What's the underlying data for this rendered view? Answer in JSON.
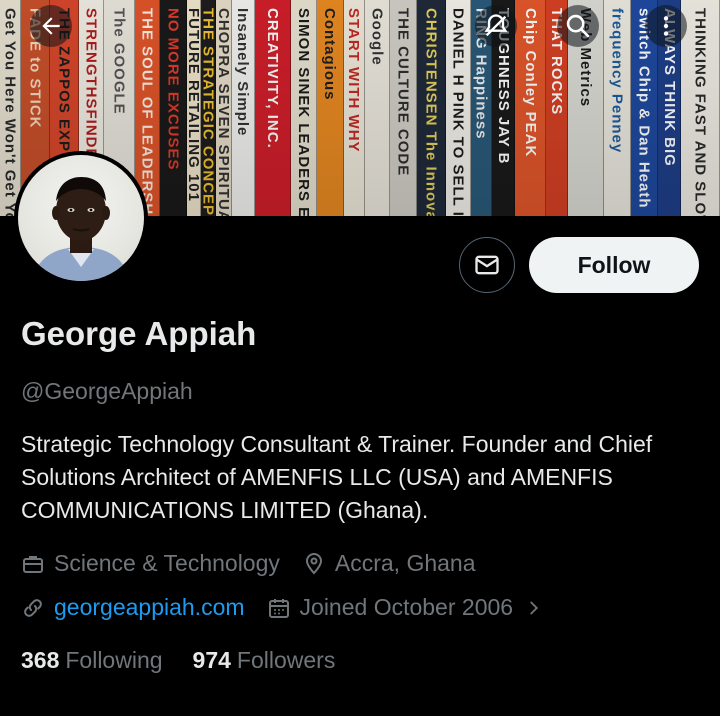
{
  "banner": {
    "books": [
      {
        "text": "Get You Here Won't Get You There",
        "bg": "#e8e2d2",
        "fg": "#2a2a2a",
        "w": 22
      },
      {
        "text": "FADE to STICK",
        "bg": "#c9502a",
        "fg": "#f1d9c0",
        "w": 30
      },
      {
        "text": "THE ZAPPOS EXP",
        "bg": "#d8472b",
        "fg": "#1c1c1c",
        "w": 30
      },
      {
        "text": "STRENGTHSFINDER",
        "bg": "#f0ede4",
        "fg": "#b21d1d",
        "w": 26
      },
      {
        "text": "The GOOGLE",
        "bg": "#e9e6dd",
        "fg": "#555",
        "w": 32
      },
      {
        "text": "THE SOUL OF LEADERSHIP",
        "bg": "#e0552a",
        "fg": "#fbeee4",
        "w": 26
      },
      {
        "text": "NO MORE EXCUSES",
        "bg": "#1a1a1a",
        "fg": "#e03b2a",
        "w": 28
      },
      {
        "text": "FUTURE RETAILING 101",
        "bg": "#f1e6cc",
        "fg": "#222",
        "w": 14
      },
      {
        "text": "THE STRATEGIC CONCEPTS",
        "bg": "#1d1d1d",
        "fg": "#f2c230",
        "w": 16
      },
      {
        "text": "CHOPRA SEVEN SPIRITUAL LAWS",
        "bg": "#e7ddc8",
        "fg": "#333",
        "w": 16
      },
      {
        "text": "Insanely Simple",
        "bg": "#f2f2f0",
        "fg": "#333",
        "w": 24
      },
      {
        "text": "CREATIVITY, INC.",
        "bg": "#d11f2a",
        "fg": "#ffffff",
        "w": 38
      },
      {
        "text": "SIMON SINEK LEADERS EAT",
        "bg": "#e8e2d0",
        "fg": "#1b1b1b",
        "w": 26
      },
      {
        "text": "Contagious",
        "bg": "#e98a22",
        "fg": "#1f1f1f",
        "w": 28
      },
      {
        "text": "START WITH WHY",
        "bg": "#efe9db",
        "fg": "#c22a23",
        "w": 22
      },
      {
        "text": "Google",
        "bg": "#ece8de",
        "fg": "#333",
        "w": 26
      },
      {
        "text": "THE CULTURE CODE",
        "bg": "#d2cfc7",
        "fg": "#2e2e2e",
        "w": 28
      },
      {
        "text": "CHRISTENSEN The Innovator's Dilemma",
        "bg": "#1f2a3a",
        "fg": "#e8d25a",
        "w": 30
      },
      {
        "text": "DANIEL H PINK TO SELL IS HUMAN",
        "bg": "#f3f1ea",
        "fg": "#1c1c1c",
        "w": 26
      },
      {
        "text": "RING Happiness",
        "bg": "#2a5a7a",
        "fg": "#f0f0f0",
        "w": 22
      },
      {
        "text": "TOUGHNESS JAY B",
        "bg": "#1a1a1a",
        "fg": "#ffffff",
        "w": 24
      },
      {
        "text": "Chip Conley PEAK",
        "bg": "#e3572b",
        "fg": "#ffffff",
        "w": 32
      },
      {
        "text": "THAT ROCKS",
        "bg": "#d64124",
        "fg": "#ffffff",
        "w": 22
      },
      {
        "text": "Web Metrics",
        "bg": "#dcdcd6",
        "fg": "#1c1c1c",
        "w": 38
      },
      {
        "text": "frequency Penney",
        "bg": "#ece9e0",
        "fg": "#1c5c9c",
        "w": 28
      },
      {
        "text": "switch Chip & Dan Heath",
        "bg": "#1f4aa0",
        "fg": "#ffffff",
        "w": 28
      },
      {
        "text": "ALWAYS THINK BIG",
        "bg": "#1e3f8a",
        "fg": "#ffffff",
        "w": 24
      },
      {
        "text": "THINKING FAST AND SLOW",
        "bg": "#f0ede5",
        "fg": "#2a2a2a",
        "w": 40
      }
    ]
  },
  "icons": {
    "back": "back-arrow-icon",
    "notify": "notification-off-icon",
    "search": "search-icon",
    "more": "more-vertical-icon",
    "message": "mail-icon"
  },
  "profile": {
    "name": "George Appiah",
    "handle": "@GeorgeAppiah",
    "bio": "Strategic Technology Consultant & Trainer. Founder and Chief Solutions Architect of AMENFIS LLC (USA) and AMENFIS COMMUNICATIONS LIMITED (Ghana).",
    "category": "Science & Technology",
    "location": "Accra, Ghana",
    "website": "georgeappiah.com",
    "joined": "Joined October 2006",
    "following_count": "368",
    "following_label": "Following",
    "followers_count": "974",
    "followers_label": "Followers"
  },
  "actions": {
    "follow_label": "Follow"
  },
  "colors": {
    "background": "#000000",
    "text_primary": "#e7e9ea",
    "text_secondary": "#71767b",
    "link": "#1d9bf0",
    "follow_bg": "#eff3f4"
  }
}
